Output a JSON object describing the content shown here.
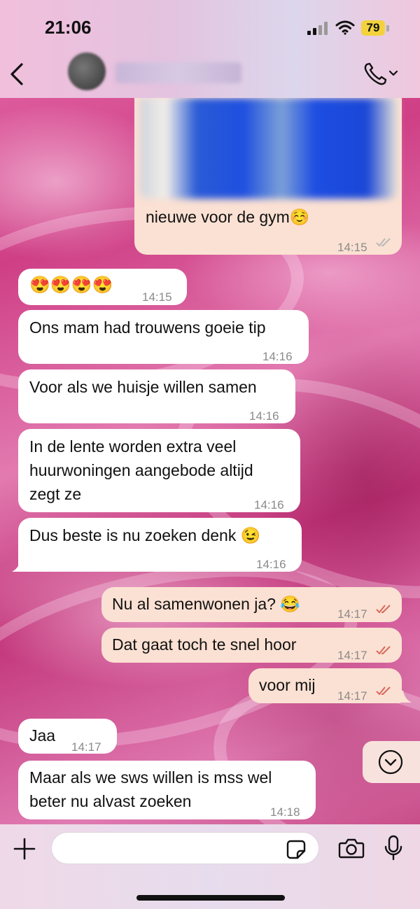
{
  "status_bar": {
    "time": "21:06",
    "battery": "79"
  },
  "header": {
    "contact_name": "",
    "avatar": "blurred-contact-photo"
  },
  "messages": [
    {
      "direction": "outgoing",
      "text": "nieuwe voor de gym☺️",
      "time": "14:15",
      "status": "delivered",
      "has_photo": true
    },
    {
      "direction": "incoming",
      "text": "😍😍😍😍",
      "time": "14:15"
    },
    {
      "direction": "incoming",
      "text": "Ons mam had trouwens goeie tip",
      "time": "14:16"
    },
    {
      "direction": "incoming",
      "text": "Voor als we huisje willen samen",
      "time": "14:16"
    },
    {
      "direction": "incoming",
      "text": "In de lente worden extra veel\nhuurwoningen aangebode altijd\nzegt ze",
      "time": "14:16"
    },
    {
      "direction": "incoming",
      "text": "Dus beste is nu zoeken denk 😉",
      "time": "14:16"
    },
    {
      "direction": "outgoing",
      "text": "Nu al samenwonen ja? 😂",
      "time": "14:17",
      "status": "read"
    },
    {
      "direction": "outgoing",
      "text": "Dat gaat toch te snel hoor",
      "time": "14:17",
      "status": "read"
    },
    {
      "direction": "outgoing",
      "text": "voor mij",
      "time": "14:17",
      "status": "read"
    },
    {
      "direction": "incoming",
      "text": "Jaa",
      "time": "14:17"
    },
    {
      "direction": "incoming",
      "text": "Maar als we sws willen is mss wel\nbeter nu alvast zoeken",
      "time": "14:18"
    }
  ],
  "composer": {
    "value": "",
    "placeholder": ""
  },
  "colors": {
    "incoming_bubble": "#ffffff",
    "outgoing_bubble": "#fbe1d3",
    "read_tick": "#d9685a",
    "delivered_tick": "#b9b9b9",
    "battery": "#f3d23c"
  },
  "icons": [
    "back-chevron-icon",
    "phone-icon",
    "chevron-down-icon",
    "plus-icon",
    "sticker-icon",
    "camera-icon",
    "microphone-icon",
    "scroll-down-icon"
  ]
}
